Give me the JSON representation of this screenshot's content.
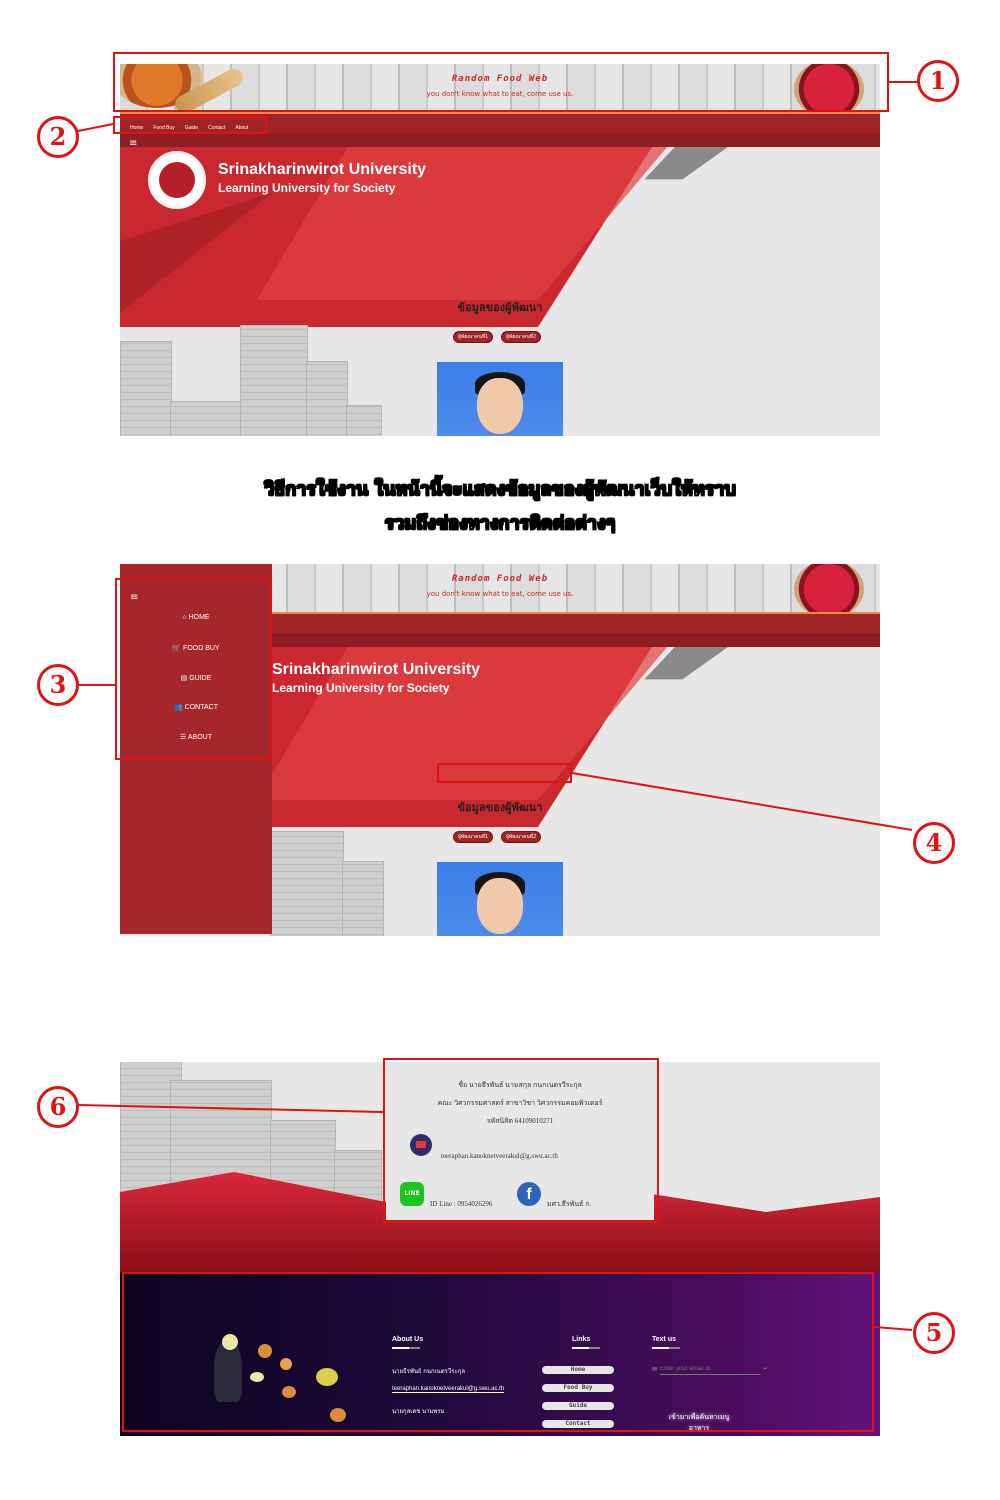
{
  "banner": {
    "title": "Random Food Web",
    "subtitle": "you don't know what to eat, come use us."
  },
  "nav": {
    "items": [
      "Home",
      "Food Buy",
      "Guide",
      "Contact",
      "About"
    ]
  },
  "hero": {
    "menu_icon": "≡",
    "university_name": "Srinakharinwirot University",
    "university_tagline": "Learning University for Society"
  },
  "developer_section": {
    "title": "ข้อมูลของผู้พัฒนา",
    "buttons": [
      "ผู้พัฒนาคนที่1",
      "ผู้พัฒนาคนที่2"
    ]
  },
  "description": {
    "line1": "วิธีการใช้งาน  ในหน้านี้จะแสดงข้อมูลของผู้พัฒนาเว็บให้ทราบ",
    "line2": "รวมถึงช่องทางการติดต่อต่างๆ"
  },
  "side_menu": {
    "items": [
      {
        "icon": "home-icon",
        "glyph": "⌂",
        "label": "HOME"
      },
      {
        "icon": "cart-icon",
        "glyph": "🛒",
        "label": "FOOD BUY"
      },
      {
        "icon": "book-icon",
        "glyph": "▤",
        "label": "GUIDE"
      },
      {
        "icon": "users-icon",
        "glyph": "👥",
        "label": "CONTACT"
      },
      {
        "icon": "database-icon",
        "glyph": "☰",
        "label": "ABOUT"
      }
    ]
  },
  "contact": {
    "name": "ชื่อ นายธีรพันธ์ นามสกุล กนกเนตรวีระกุล",
    "faculty": "คณะ วิศวกรรมศาสตร์ สาขาวิชา วิศวกรรมคอมพิวเตอร์",
    "student_id": "รหัสนิสิต 64109010271",
    "email": "teeraphan.kanoknetveerakul@g.swu.ac.th",
    "line_id": "ID Line : 0954026296",
    "facebook": "มศว.ธีรพันธ์ ก.",
    "line_logo": "LINE",
    "facebook_logo": "f"
  },
  "footer": {
    "about_heading": "About Us",
    "about_lines": [
      "นายธีรพันธ์ กนกเนตรวีระกุล",
      "teeraphan.kanoknetveerakul@g.swu.ac.th",
      "นายกุลเดช นามพรม"
    ],
    "links_heading": "Links",
    "links": [
      "Home",
      "Food Buy",
      "Guide",
      "Contact"
    ],
    "text_heading": "Text us",
    "email_placeholder": "Enter your email id",
    "send_arrow": "→",
    "promo": "เข้ามาเพื่อค้นหาเมนูอาหาร"
  },
  "callouts": [
    "1",
    "2",
    "3",
    "4",
    "5",
    "6"
  ],
  "colors": {
    "accent_red": "#e11212",
    "brand_red": "#a02325",
    "footer_purple": "#4a0c5e"
  }
}
